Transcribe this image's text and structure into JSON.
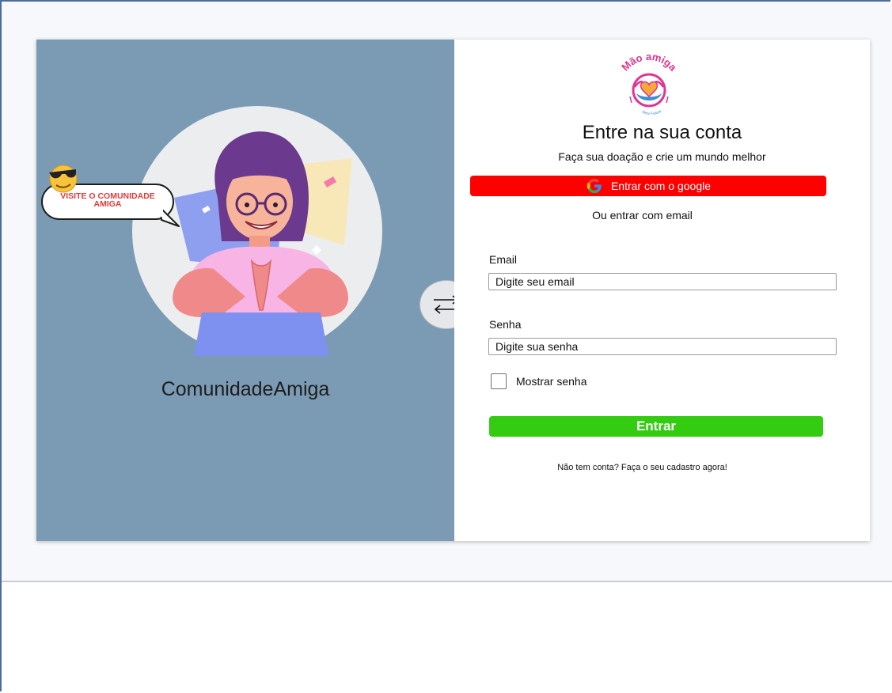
{
  "left": {
    "brand_caption": "ComunidadeAmiga",
    "bubble_text": "VISITE O COMUNIDADE AMIGA"
  },
  "logo": {
    "text_top": "Mão amiga",
    "text_bottom": "New Future"
  },
  "login": {
    "title": "Entre na sua conta",
    "subtitle": "Faça sua doação e crie um mundo melhor",
    "google_button_label": "Entrar com o google",
    "or_text": "Ou entrar com email",
    "email_label": "Email",
    "email_placeholder": "Digite seu email",
    "password_label": "Senha",
    "password_placeholder": "Digite sua senha",
    "show_password_label": "Mostrar senha",
    "submit_label": "Entrar",
    "signup_text": "Não tem conta? Faça o seu cadastro agora!"
  },
  "icons": {
    "swap": "swap-arrows-icon",
    "google": "google-icon",
    "emoji": "sunglasses-emoji-icon"
  },
  "colors": {
    "left_panel": "#7a9bb3",
    "google_button": "#ff0000",
    "submit_button": "#33cc11",
    "logo_pink": "#e0358f",
    "logo_blue": "#3b8fd6"
  }
}
